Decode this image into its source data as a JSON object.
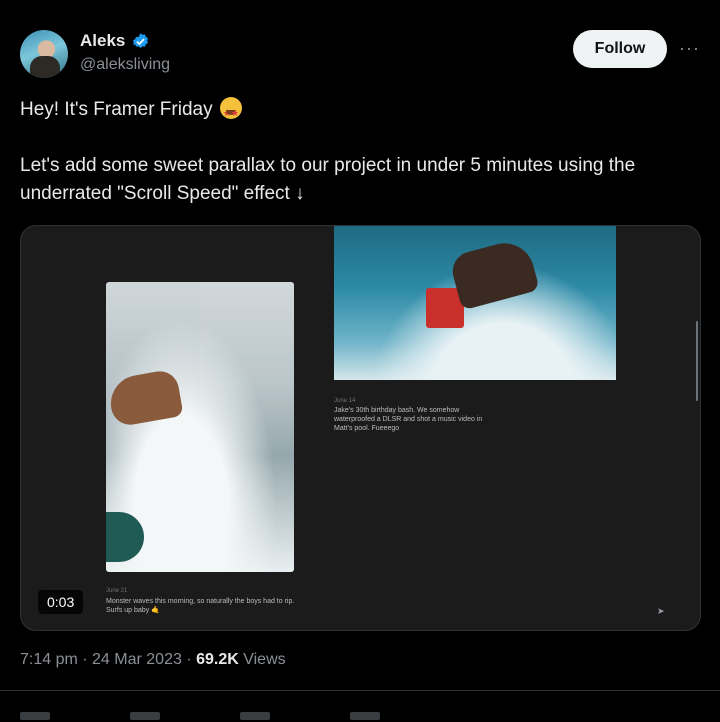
{
  "author": {
    "display_name": "Aleks",
    "handle": "@aleksliving",
    "verified_icon": "verified-badge-icon",
    "verified_color": "#1d9bf0"
  },
  "header": {
    "follow_label": "Follow",
    "more_label": "···"
  },
  "post": {
    "line1": "Hey! It's Framer Friday",
    "line1_emoji": "star-struck-emoji",
    "line2": "Let's add some sweet parallax to our project in under 5 minutes using the underrated \"Scroll Speed\" effect ↓"
  },
  "media": {
    "duration": "0:03",
    "caption_right_date": "June 14",
    "caption_right_text": "Jake's 30th birthday bash. We somehow waterproofed a DLSR and shot a music video in Matt's pool. Fueeego",
    "caption_left_date": "June 21",
    "caption_left_text": "Monster waves this morning, so naturally the boys had to rip. Surfs up baby 🤙"
  },
  "meta": {
    "time": "7:14 pm · 24 Mar 2023 · ",
    "views_count": "69.2K",
    "views_label": " Views"
  },
  "colors": {
    "background": "#000000",
    "text": "#e7e9ea",
    "muted": "#8b9096",
    "follow_bg": "#eff3f4"
  }
}
